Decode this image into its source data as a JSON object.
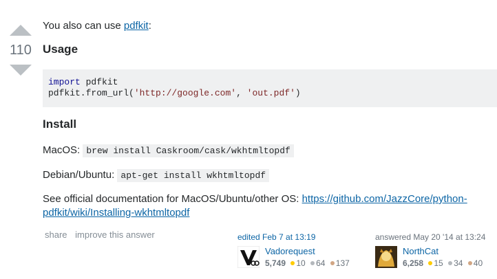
{
  "vote": {
    "score": "110"
  },
  "intro": {
    "text": "You also can use ",
    "link": "pdfkit",
    "suffix": ":"
  },
  "usage": {
    "heading": "Usage",
    "code_line1_kw": "import",
    "code_line1_rest": " pdfkit",
    "code_line2_a": "pdfkit.from_url(",
    "code_line2_s1": "'http://google.com'",
    "code_line2_b": ", ",
    "code_line2_s2": "'out.pdf'",
    "code_line2_c": ")"
  },
  "install": {
    "heading": "Install",
    "mac_label": "MacOS:",
    "mac_cmd": "brew install Caskroom/cask/wkhtmltopdf",
    "debian_label": "Debian/Ubuntu:",
    "debian_cmd": "apt-get install wkhtmltopdf",
    "docs_text": "See official documentation for MacOS/Ubuntu/other OS: ",
    "docs_link_line1": "https://github.com/JazzCore/python-",
    "docs_link_line2": "pdfkit/wiki/Installing-wkhtmltopdf"
  },
  "post_menu": {
    "share": "share",
    "improve": "improve this answer"
  },
  "editor": {
    "action": "edited Feb 7 at 13:19",
    "name": "Vadorequest",
    "rep": "5,749",
    "gold": "10",
    "silver": "64",
    "bronze": "137"
  },
  "author": {
    "action": "answered May 20 '14 at 13:24",
    "name": "NorthCat",
    "rep": "6,258",
    "gold": "15",
    "silver": "34",
    "bronze": "40"
  },
  "colors": {
    "link": "#0c65a5",
    "code_bg": "#eff0f1",
    "gold": "#ffcc01",
    "silver": "#b4b8bc",
    "bronze": "#d1a684"
  }
}
